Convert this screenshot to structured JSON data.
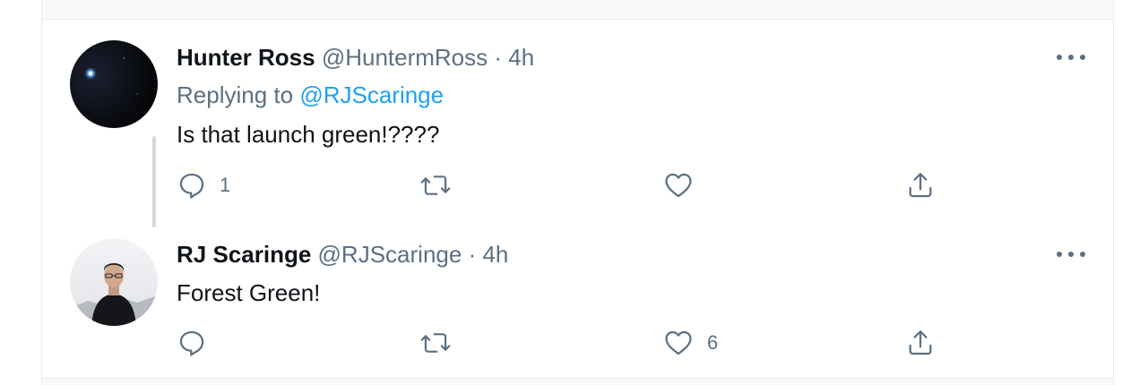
{
  "tweets": [
    {
      "name": "Hunter Ross",
      "handle": "@HuntermRoss",
      "separator": "·",
      "time": "4h",
      "replying_prefix": "Replying to",
      "replying_mention": "@RJScaringe",
      "text": "Is that launch green!????",
      "reply_count": "1",
      "like_count": ""
    },
    {
      "name": "RJ Scaringe",
      "handle": "@RJScaringe",
      "separator": "·",
      "time": "4h",
      "text": "Forest Green!",
      "reply_count": "",
      "like_count": "6"
    }
  ],
  "icons": {
    "reply": "speech-bubble-icon",
    "retweet": "retweet-icon",
    "like": "heart-icon",
    "share": "share-icon",
    "more": "more-options-icon"
  },
  "colors": {
    "link": "#1da1f2",
    "secondary_text": "#5b7083",
    "primary_text": "#0f1419",
    "thread_line": "#cfd9de"
  }
}
